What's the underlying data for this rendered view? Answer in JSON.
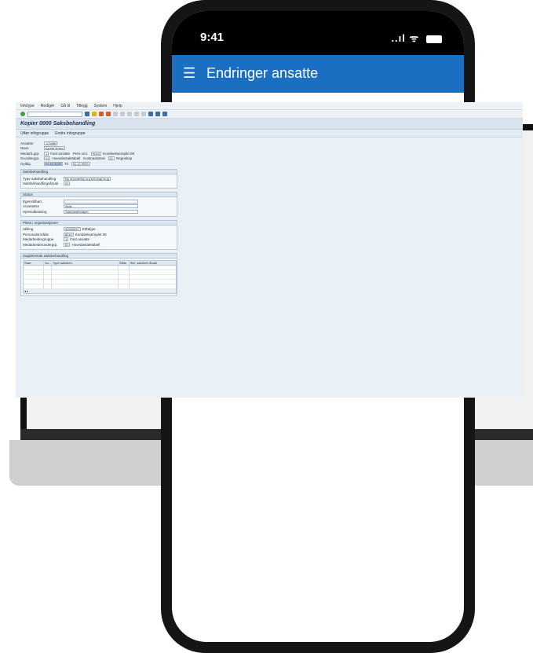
{
  "phone": {
    "time": "9:41",
    "signal_icons": "..ıl ᯤ",
    "menu_icon": "hamburger-menu-icon",
    "app_title": "Endringer ansatte"
  },
  "sap": {
    "menu": [
      "Infotype",
      "Redigér",
      "Gå til",
      "Tillegg",
      "System",
      "Hjelp"
    ],
    "title": "Kopier 0000 Saksbehandling",
    "appbar": [
      "Utfør infogruppe",
      "Endre infogruppe"
    ],
    "header": {
      "ansattnr_label": "Ansattnr",
      "ansattnr_value": "123456",
      "navn_label": "Navn",
      "navn_value": "Kjersti Ileaco",
      "medarbgrp_label": "Medarb.grp.",
      "medarbgrp_value": "1",
      "medarbgrp_text": "Fast ansatte",
      "persomr_label": "Pers.omr.",
      "persomr_value": "8010",
      "persomr_text": "Kundeeksemplet 08",
      "medarbundergrp_label": "M.undergrp.",
      "medarbundergrp_value": "01",
      "medarbundergrp_text": "Hovedavtaletabell",
      "kostnadssted_label": "Kostnadssted",
      "kostnadssted_value": "01",
      "kostnadssted_text": "Regnskap",
      "gyldig_label": "Gyldig",
      "gyldig_from": "01.10.2020",
      "gyldig_til_label": "Til",
      "gyldig_to": "31.12.9999"
    },
    "saksbehandling": {
      "heading": "Saksbehandling",
      "type_label": "Type saksbehandling",
      "type_value": "Ny st.kode/Ny org.enh/Ingl.lnug",
      "grunn_label": "Saksbehandlingsårsak",
      "grunn_value": "01"
    },
    "status": {
      "heading": "Status",
      "rows": [
        {
          "label": "Egenstilhørt",
          "value": ""
        },
        {
          "label": "Ansettelse",
          "value": "Aktiv"
        },
        {
          "label": "Spesialbetaling",
          "value": "Standardbeløpet"
        }
      ]
    },
    "plass": {
      "heading": "Plass i organisasjonen",
      "rows": [
        {
          "label": "Stilling",
          "value": "99999997",
          "text": "Ettfølger"
        },
        {
          "label": "Personalområde",
          "value": "8010",
          "text": "Kundeeksemplet 08"
        },
        {
          "label": "Medarbeidergruppe",
          "value": "1",
          "text": "Fast ansatte"
        },
        {
          "label": "Medarbeiderundergrp.",
          "value": "01",
          "text": "Hovedavtaletabell"
        }
      ]
    },
    "supplerende": {
      "heading": "Supplerende saksbehandling",
      "columns": [
        "Start",
        "Su...",
        "Type saksbeh.",
        "Slåte",
        "Bet. saksbeh.årsak"
      ]
    }
  }
}
